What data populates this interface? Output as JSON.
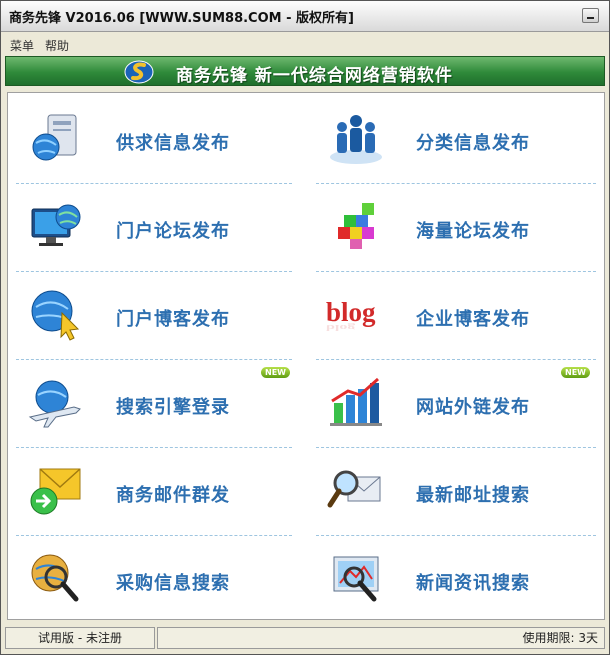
{
  "window": {
    "title": "商务先锋  V2016.06  [WWW.SUM88.COM - 版权所有]"
  },
  "menu": {
    "items": [
      "菜单",
      "帮助"
    ]
  },
  "banner": {
    "text": "商务先锋  新一代综合网络营销软件"
  },
  "tiles": [
    {
      "label": "供求信息发布",
      "icon": "computer-globe-icon"
    },
    {
      "label": "分类信息发布",
      "icon": "people-group-icon"
    },
    {
      "label": "门户论坛发布",
      "icon": "monitor-globe-icon"
    },
    {
      "label": "海量论坛发布",
      "icon": "colored-cubes-icon"
    },
    {
      "label": "门户博客发布",
      "icon": "globe-cursor-icon"
    },
    {
      "label": "企业博客发布",
      "icon": "blog-logo-icon",
      "logo_text": "blog"
    },
    {
      "label": "搜索引擎登录",
      "icon": "airplane-globe-icon",
      "badge": "NEW"
    },
    {
      "label": "网站外链发布",
      "icon": "bar-chart-icon",
      "badge": "NEW"
    },
    {
      "label": "商务邮件群发",
      "icon": "mail-envelope-icon"
    },
    {
      "label": "最新邮址搜索",
      "icon": "mail-search-icon"
    },
    {
      "label": "采购信息搜索",
      "icon": "globe-magnifier-icon"
    },
    {
      "label": "新闻资讯搜索",
      "icon": "screen-magnifier-icon"
    }
  ],
  "status": {
    "left": "试用版 - 未注册",
    "right": "使用期限: 3天"
  },
  "colors": {
    "label": "#2d6fb0",
    "banner": "#2f8a3a",
    "separator": "#9ec5e0"
  }
}
